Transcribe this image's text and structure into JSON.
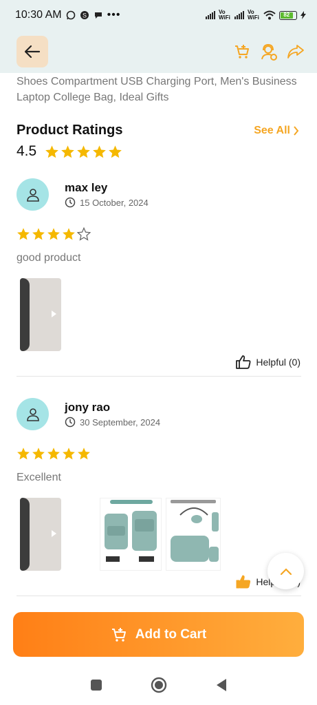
{
  "status_bar": {
    "time": "10:30 AM",
    "wifi_label_1": "Vo WiFi",
    "wifi_label_2": "Vo WiFi",
    "battery": "82"
  },
  "header": {
    "back_icon": "arrow-left-icon",
    "actions": [
      "cart-add-icon",
      "support-agent-icon",
      "share-icon"
    ],
    "accent_color": "#f5a623"
  },
  "product": {
    "description": "Shoes Compartment  USB Charging Port, Men's Business Laptop College Bag, Ideal Gifts"
  },
  "ratings": {
    "title": "Product Ratings",
    "see_all": "See All",
    "overall_score": "4.5",
    "overall_stars": 5
  },
  "reviews": [
    {
      "name": "max ley",
      "date": "15 October, 2024",
      "stars": 4,
      "text": "good product",
      "helpful": "Helpful (0)",
      "media": [
        "video"
      ]
    },
    {
      "name": "jony rao",
      "date": "30 September, 2024",
      "stars": 5,
      "text": "Excellent",
      "helpful": "Helpful (0)",
      "media": [
        "video",
        "image",
        "image"
      ]
    }
  ],
  "actions": {
    "add_to_cart": "Add to Cart"
  }
}
